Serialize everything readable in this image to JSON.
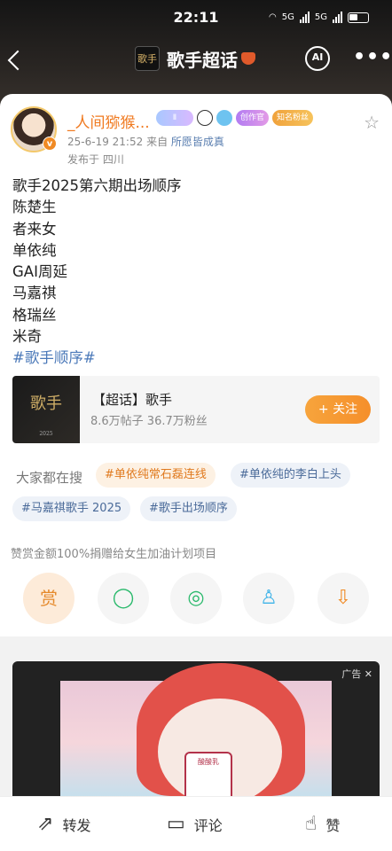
{
  "status": {
    "time": "22:11",
    "net1": "5G",
    "net2": "5G"
  },
  "nav": {
    "logo_text": "歌手",
    "title": "歌手超话",
    "ai_label": "AI",
    "more_label": "•••"
  },
  "post": {
    "username": "_人间猕猴...",
    "badges": {
      "level": "Ⅱ",
      "creator": "创作官",
      "fan": "知名粉丝"
    },
    "date": "25-6-19 21:52",
    "source_prefix": "来自",
    "source": "所愿皆成真",
    "location": "发布于 四川",
    "lines": [
      "歌手2025第六期出场顺序",
      "陈楚生",
      "者来女",
      "单依纯",
      "GAI周延",
      "马嘉祺",
      "格瑞丝",
      "米奇"
    ],
    "hashtag": "#歌手顺序#"
  },
  "topic": {
    "thumb_text": "歌手",
    "thumb_sub": "2025",
    "name": "【超话】歌手",
    "stats": "8.6万帖子 36.7万粉丝",
    "follow_label": "+ 关注"
  },
  "search": {
    "label": "大家都在搜",
    "chips": [
      "#单依纯常石磊连线",
      "#单依纯的李白上头",
      "#马嘉祺歌手 2025",
      "#歌手出场顺序"
    ]
  },
  "donate_note": "赞赏金额100%捐赠给女生加油计划项目",
  "share": {
    "reward": "赏",
    "wechat": "◯",
    "moments": "◎",
    "qq": "♙",
    "save": "⇩"
  },
  "ad": {
    "label": "广告 ✕",
    "product": "酸酸乳"
  },
  "bottom": {
    "repost": "转发",
    "comment": "评论",
    "like": "赞"
  }
}
